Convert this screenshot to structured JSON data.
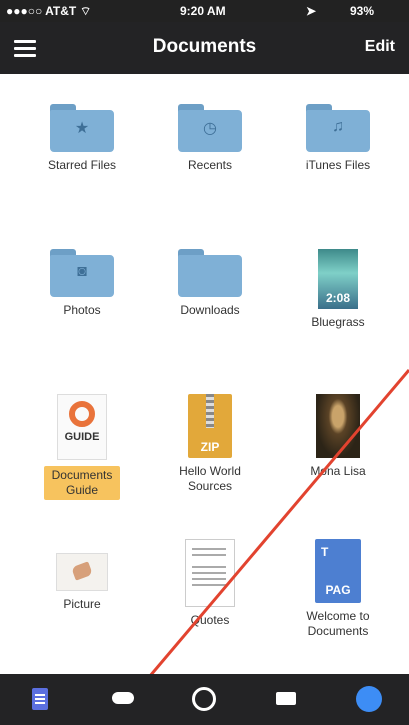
{
  "status_bar": {
    "carrier": "●●●○○ AT&T",
    "time": "9:20 AM",
    "battery": "93%"
  },
  "nav": {
    "title": "Documents",
    "edit_label": "Edit"
  },
  "items": [
    {
      "label": "Starred Files",
      "icon": "star-folder-icon"
    },
    {
      "label": "Recents",
      "icon": "clock-folder-icon"
    },
    {
      "label": "iTunes Files",
      "icon": "music-folder-icon"
    },
    {
      "label": "Photos",
      "icon": "camera-folder-icon"
    },
    {
      "label": "Downloads",
      "icon": "folder-icon"
    },
    {
      "label": "Bluegrass",
      "icon": "video-thumbnail",
      "duration": "2:08"
    },
    {
      "label": "Documents Guide",
      "icon": "guide-document-icon",
      "badge": "GUIDE",
      "selected": true
    },
    {
      "label": "Hello World Sources",
      "icon": "zip-file-icon",
      "badge": "ZIP"
    },
    {
      "label": "Mona Lisa",
      "icon": "image-thumbnail"
    },
    {
      "label": "Picture",
      "icon": "picture-thumbnail"
    },
    {
      "label": "Quotes",
      "icon": "text-document-thumbnail"
    },
    {
      "label": "Welcome to Documents",
      "icon": "pages-document-icon",
      "badge": "PAG"
    }
  ],
  "tab_bar": [
    "documents-tab-icon",
    "cloud-tab-icon",
    "wifi-tab-icon",
    "cart-tab-icon",
    "compass-tab-icon"
  ],
  "colors": {
    "accent": "#f7c35e",
    "folder": "#7fb0d6",
    "bar": "#232325"
  }
}
